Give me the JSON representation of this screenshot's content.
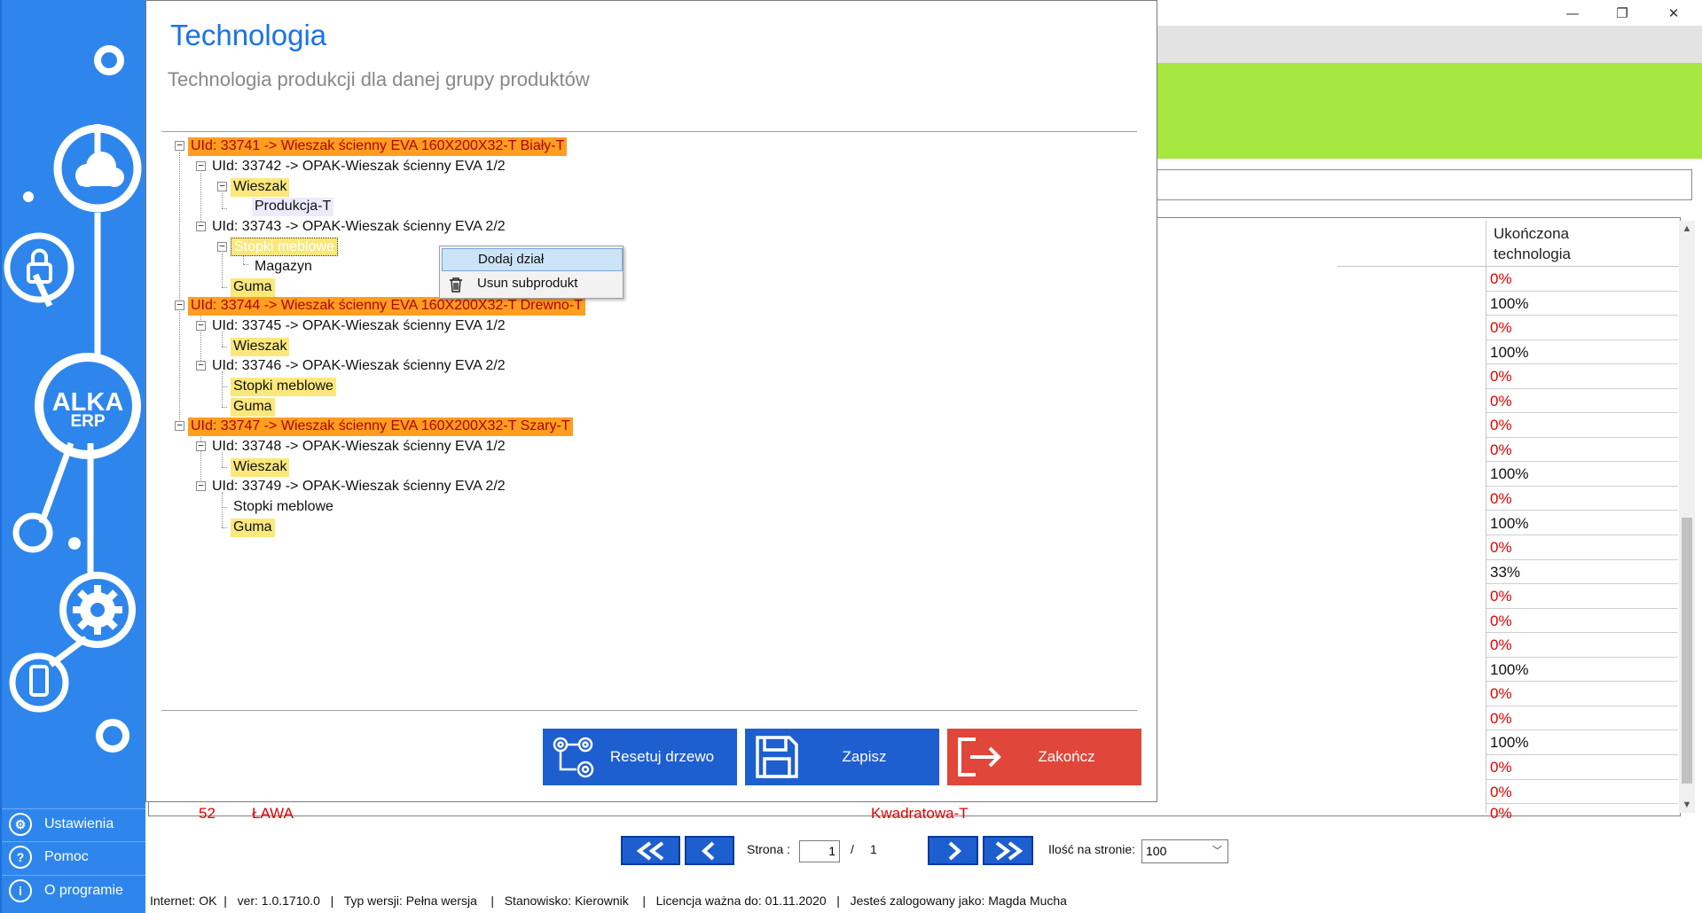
{
  "window": {
    "controls": {
      "minimize": "—",
      "restore": "❐",
      "close": "✕"
    }
  },
  "grid": {
    "header": {
      "line1": "Ukończona",
      "line2": "technologia"
    },
    "rows": [
      {
        "value": "0%",
        "red": true
      },
      {
        "value": "100%",
        "red": false
      },
      {
        "value": "0%",
        "red": true
      },
      {
        "value": "100%",
        "red": false
      },
      {
        "value": "0%",
        "red": true
      },
      {
        "value": "0%",
        "red": true
      },
      {
        "value": "0%",
        "red": true
      },
      {
        "value": "0%",
        "red": true
      },
      {
        "value": "100%",
        "red": false
      },
      {
        "value": "0%",
        "red": true
      },
      {
        "value": "100%",
        "red": false
      },
      {
        "value": "0%",
        "red": true
      },
      {
        "value": "33%",
        "red": false
      },
      {
        "value": "0%",
        "red": true
      },
      {
        "value": "0%",
        "red": true
      },
      {
        "value": "0%",
        "red": true
      },
      {
        "value": "100%",
        "red": false
      },
      {
        "value": "0%",
        "red": true
      },
      {
        "value": "0%",
        "red": true
      },
      {
        "value": "100%",
        "red": false
      },
      {
        "value": "0%",
        "red": true
      },
      {
        "value": "0%",
        "red": true
      }
    ],
    "partial_row": {
      "num": "52",
      "name": "ŁAWA",
      "variant": "Kwadratowa-T",
      "value": "0%"
    }
  },
  "pagination": {
    "first": "«",
    "prev": "‹",
    "next": "›",
    "last": "»",
    "page_label": "Strona :",
    "page_value": "1",
    "separator": "/",
    "total_pages": "1",
    "per_page_label": "Ilość na stronie:",
    "per_page_value": "100"
  },
  "statusbar": {
    "text": "Internet: OK  |   ver: 1.0.1710.0   |   Typ wersji: Pełna wersja    |   Stanowisko: Kierownik    |   Licencja ważna do: 01.11.2020   |   Jesteś zalogowany jako: Magda Mucha"
  },
  "sidebar": {
    "logo_line1": "ALKA",
    "logo_line2": "ERP",
    "menu": [
      {
        "label": "Ustawienia",
        "icon": "settings-icon",
        "glyph": "⚙"
      },
      {
        "label": "Pomoc",
        "icon": "help-icon",
        "glyph": "?"
      },
      {
        "label": "O programie",
        "icon": "info-icon",
        "glyph": "i"
      }
    ]
  },
  "dialog": {
    "title": "Technologia",
    "subtitle": "Technologia produkcji dla danej grupy produktów",
    "tree": {
      "n1": "UId: 33741 -> Wieszak ścienny EVA 160X200X32-T Biały-T",
      "n1a": "UId: 33742 -> OPAK-Wieszak ścienny EVA    1/2",
      "n1a1": "Wieszak",
      "n1a1a": "Produkcja-T",
      "n1b": "UId: 33743 -> OPAK-Wieszak ścienny EVA    2/2",
      "n1b1": "Stopki meblowe",
      "n1b1a": "Magazyn",
      "n1b2": "Guma",
      "n2": "UId: 33744 -> Wieszak ścienny EVA 160X200X32-T Drewno-T",
      "n2a": "UId: 33745 -> OPAK-Wieszak ścienny EVA    1/2",
      "n2a1": "Wieszak",
      "n2b": "UId: 33746 -> OPAK-Wieszak ścienny EVA    2/2",
      "n2b1": "Stopki meblowe",
      "n2b2": "Guma",
      "n3": "UId: 33747 -> Wieszak ścienny EVA 160X200X32-T Szary-T",
      "n3a": "UId: 33748 -> OPAK-Wieszak ścienny EVA    1/2",
      "n3a1": "Wieszak",
      "n3b": "UId: 33749 -> OPAK-Wieszak ścienny EVA    2/2",
      "n3b1": "Stopki meblowe",
      "n3b2": "Guma"
    },
    "context_menu": {
      "add_department": "Dodaj dział",
      "remove_subproduct": "Usun subprodukt"
    },
    "buttons": {
      "reset": "Resetuj drzewo",
      "save": "Zapisz",
      "finish": "Zakończ"
    },
    "colors": {
      "title_blue": "#1a73e8",
      "button_blue": "#1e5fd0",
      "button_red": "#e0463a",
      "node_orange": "#ff9e1f",
      "node_yellow": "#fbe87c"
    }
  }
}
